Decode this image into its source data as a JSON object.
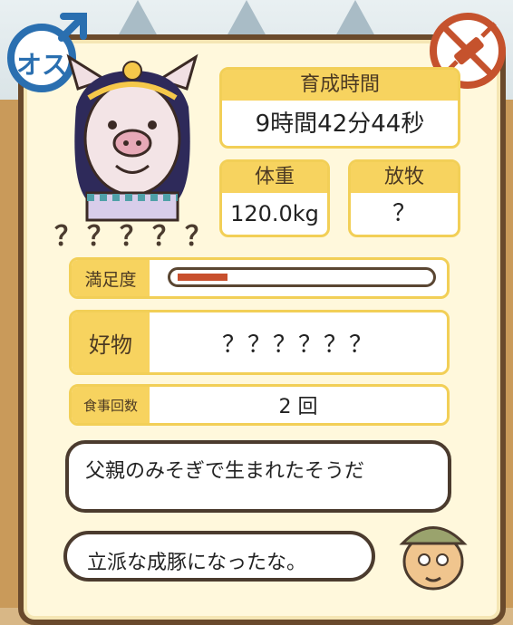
{
  "pig": {
    "name": "？？？？？"
  },
  "gender": {
    "label": "オス",
    "icon": "male-symbol-icon",
    "color": "#2a6fb0"
  },
  "item": {
    "icon": "syringe-icon",
    "color": "#c5522d"
  },
  "stats": {
    "raising_time_label": "育成時間",
    "raising_time_value": "9時間42分44秒",
    "weight_label": "体重",
    "weight_value": "120.0kg",
    "grazing_label": "放牧",
    "grazing_value": "？"
  },
  "satisfaction": {
    "label": "満足度",
    "level": 0.2,
    "color": "#c8502e"
  },
  "favorite": {
    "label": "好物",
    "value": "？？？？？？"
  },
  "meals": {
    "label": "食事回数",
    "value": "2 回"
  },
  "dialogue": {
    "bubble1": "父親のみそぎで生まれたそうだ",
    "bubble2": "立派な成豚になったな。"
  }
}
